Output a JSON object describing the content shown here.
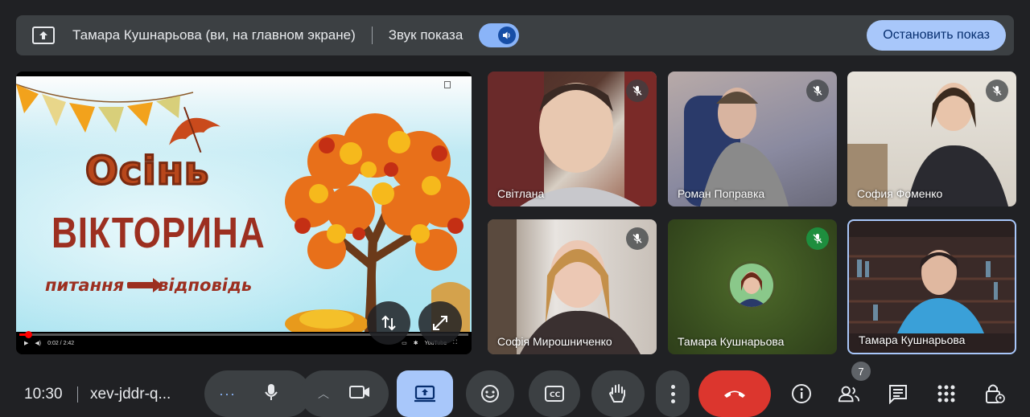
{
  "presenting_bar": {
    "presenter_text": "Тамара Кушнарьова (ви, на главном экране)",
    "sound_label": "Звук показа",
    "sound_enabled": true,
    "stop_label": "Остановить показ"
  },
  "shared_screen": {
    "slide_title": "Осінь",
    "slide_subtitle": "ВІКТОРИНА",
    "slide_question": "питання",
    "slide_answer": "відповідь",
    "video_time": "0:02 / 2:42",
    "youtube_label": "YouTube",
    "progress_fraction": 0.014
  },
  "participants": [
    {
      "name": "Світлана",
      "muted": true
    },
    {
      "name": "Роман Поправка",
      "muted": true
    },
    {
      "name": "София Фоменко",
      "muted": true
    },
    {
      "name": "Софія Мирошниченко",
      "muted": true
    },
    {
      "name": "Тамара Кушнарьова",
      "muted": true,
      "mute_color": "#1e8e3e"
    },
    {
      "name": "Тамара Кушнарьова",
      "muted": false,
      "active": true
    }
  ],
  "bottom_bar": {
    "time": "10:30",
    "meeting_code": "xev-jddr-q...",
    "participant_count": "7"
  },
  "colors": {
    "background": "#202124",
    "accent": "#a8c7fa",
    "end_call": "#dc362e"
  }
}
